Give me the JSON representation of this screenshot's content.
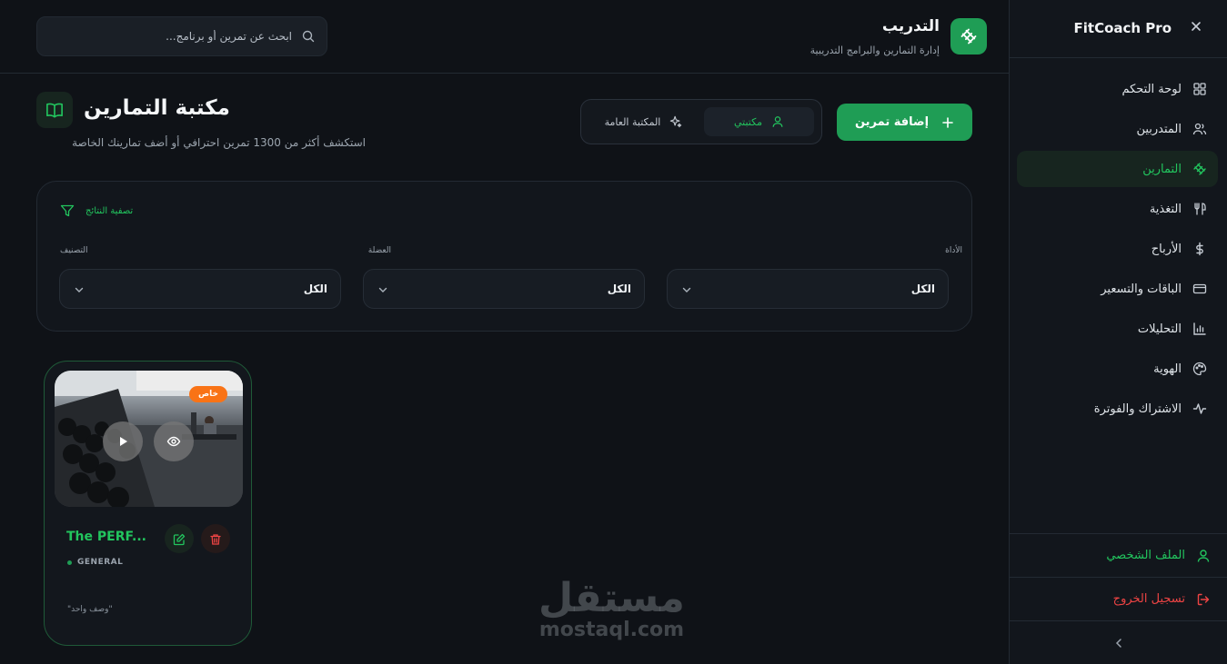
{
  "sidebar": {
    "brand": "FitCoach Pro",
    "items": [
      {
        "label": "لوحة التحكم",
        "icon": "dashboard-icon",
        "active": false
      },
      {
        "label": "المتدربين",
        "icon": "users-icon",
        "active": false
      },
      {
        "label": "التمارين",
        "icon": "dumbbell-icon",
        "active": true
      },
      {
        "label": "التغذية",
        "icon": "utensils-icon",
        "active": false
      },
      {
        "label": "الأرباح",
        "icon": "dollar-icon",
        "active": false
      },
      {
        "label": "الباقات والتسعير",
        "icon": "credit-card-icon",
        "active": false
      },
      {
        "label": "التحليلات",
        "icon": "bar-chart-icon",
        "active": false
      },
      {
        "label": "الهوية",
        "icon": "palette-icon",
        "active": false
      },
      {
        "label": "الاشتراك والفوترة",
        "icon": "activity-icon",
        "active": false
      }
    ],
    "profile_label": "الملف الشخصي",
    "logout_label": "تسجيل الخروج"
  },
  "header": {
    "title": "التدريب",
    "subtitle": "إدارة التمارين والبرامج التدريبية",
    "search_placeholder": "ابحث عن تمرين أو برنامج..."
  },
  "page": {
    "title": "مكتبة التمارين",
    "subtitle": "استكشف أكثر من 1300 تمرين احترافي أو أضف تمارينك الخاصة",
    "add_button": "إضافة تمرين",
    "tabs": [
      {
        "label": "مكتبتي",
        "icon": "user-icon",
        "active": true
      },
      {
        "label": "المكتبة العامة",
        "icon": "sparkles-icon",
        "active": false
      }
    ]
  },
  "filters": {
    "heading": "تصفية النتائج",
    "fields": [
      {
        "label": "الأداة",
        "value": "الكل"
      },
      {
        "label": "العضلة",
        "value": "الكل"
      },
      {
        "label": "التصنيف",
        "value": "الكل"
      }
    ]
  },
  "exercises": [
    {
      "title": "The PERF...",
      "badge": "خاص",
      "category": "GENERAL",
      "description": "\"وصف واحد\""
    }
  ],
  "watermark": {
    "arabic": "مستقل",
    "latin": "mostaql.com"
  },
  "colors": {
    "accent": "#22c55e",
    "accent_dark": "#1f9d55",
    "danger": "#ef4444",
    "badge": "#f97316",
    "background": "#0f1217"
  }
}
